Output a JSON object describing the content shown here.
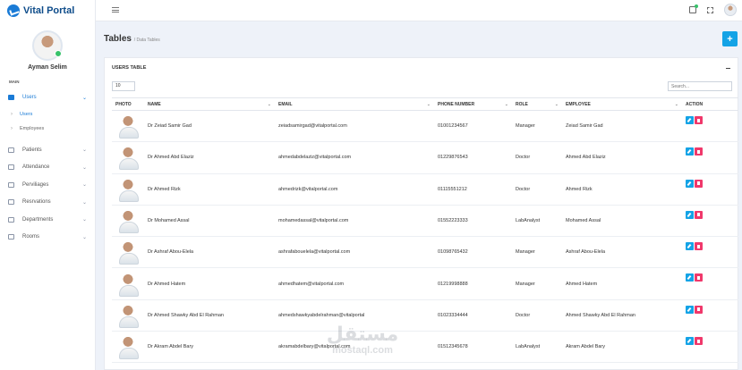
{
  "brand": {
    "name": "Vital Portal"
  },
  "user": {
    "name": "Ayman Selim"
  },
  "sidebar": {
    "section": "MAIN",
    "users": {
      "label": "Users",
      "sub": [
        "Users",
        "Employees"
      ]
    },
    "items": [
      {
        "label": "Patients",
        "icon": "patients-icon"
      },
      {
        "label": "Attendance",
        "icon": "attendance-icon"
      },
      {
        "label": "Perviliages",
        "icon": "toggle-icon"
      },
      {
        "label": "Resrvations",
        "icon": "reservations-icon"
      },
      {
        "label": "Departments",
        "icon": "departments-icon"
      },
      {
        "label": "Rooms",
        "icon": "rooms-icon"
      }
    ]
  },
  "header": {
    "title": "Tables",
    "breadcrumb": "/ Data Tables",
    "add_label": "+"
  },
  "card": {
    "title": "USERS TABLE",
    "page_size": "10",
    "search_placeholder": "Search...",
    "columns": [
      "PHOTO",
      "NAME",
      "EMAIL",
      "PHONE NUMBER",
      "ROLE",
      "EMPLOYEE",
      "ACTION"
    ]
  },
  "rows": [
    {
      "name": "Dr Zeiad Samir Gad",
      "email": "zeiadsamirgad@vitalportal.com",
      "phone": "01001234567",
      "role": "Manager",
      "employee": "Zeiad Samir Gad"
    },
    {
      "name": "Dr Ahmed Abd Elaziz",
      "email": "ahmedabdelaziz@vitalportal.com",
      "phone": "01229876543",
      "role": "Doctor",
      "employee": "Ahmed Abd Elaziz"
    },
    {
      "name": "Dr Ahmed Rizk",
      "email": "ahmedrizk@vitalportal.com",
      "phone": "01115551212",
      "role": "Doctor",
      "employee": "Ahmed Rizk"
    },
    {
      "name": "Dr Mohamed Assal",
      "email": "mohamedassal@vitalportal.com",
      "phone": "01552223333",
      "role": "LabAnalyst",
      "employee": "Mohamed Assal"
    },
    {
      "name": "Dr Ashraf Abou-Elela",
      "email": "ashrafabouelela@vitalportal.com",
      "phone": "01098765432",
      "role": "Manager",
      "employee": "Ashraf Abou-Elela"
    },
    {
      "name": "Dr Ahmed Hatem",
      "email": "ahmedhatem@vitalportal.com",
      "phone": "01219998888",
      "role": "Manager",
      "employee": "Ahmed Hatem"
    },
    {
      "name": "Dr Ahmed Shawky Abd El Rahman",
      "email": "ahmedshawkyabdelrahman@vitalportal",
      "phone": "01023334444",
      "role": "Doctor",
      "employee": "Ahmed Shawky Abd El Rahman"
    },
    {
      "name": "Dr Akram Abdel Bary",
      "email": "akramabdelbary@vitalportal.com",
      "phone": "01512345678",
      "role": "LabAnalyst",
      "employee": "Akram Abdel Bary"
    }
  ],
  "watermark": {
    "arabic": "مستقل",
    "latin": "mostaql.com"
  }
}
